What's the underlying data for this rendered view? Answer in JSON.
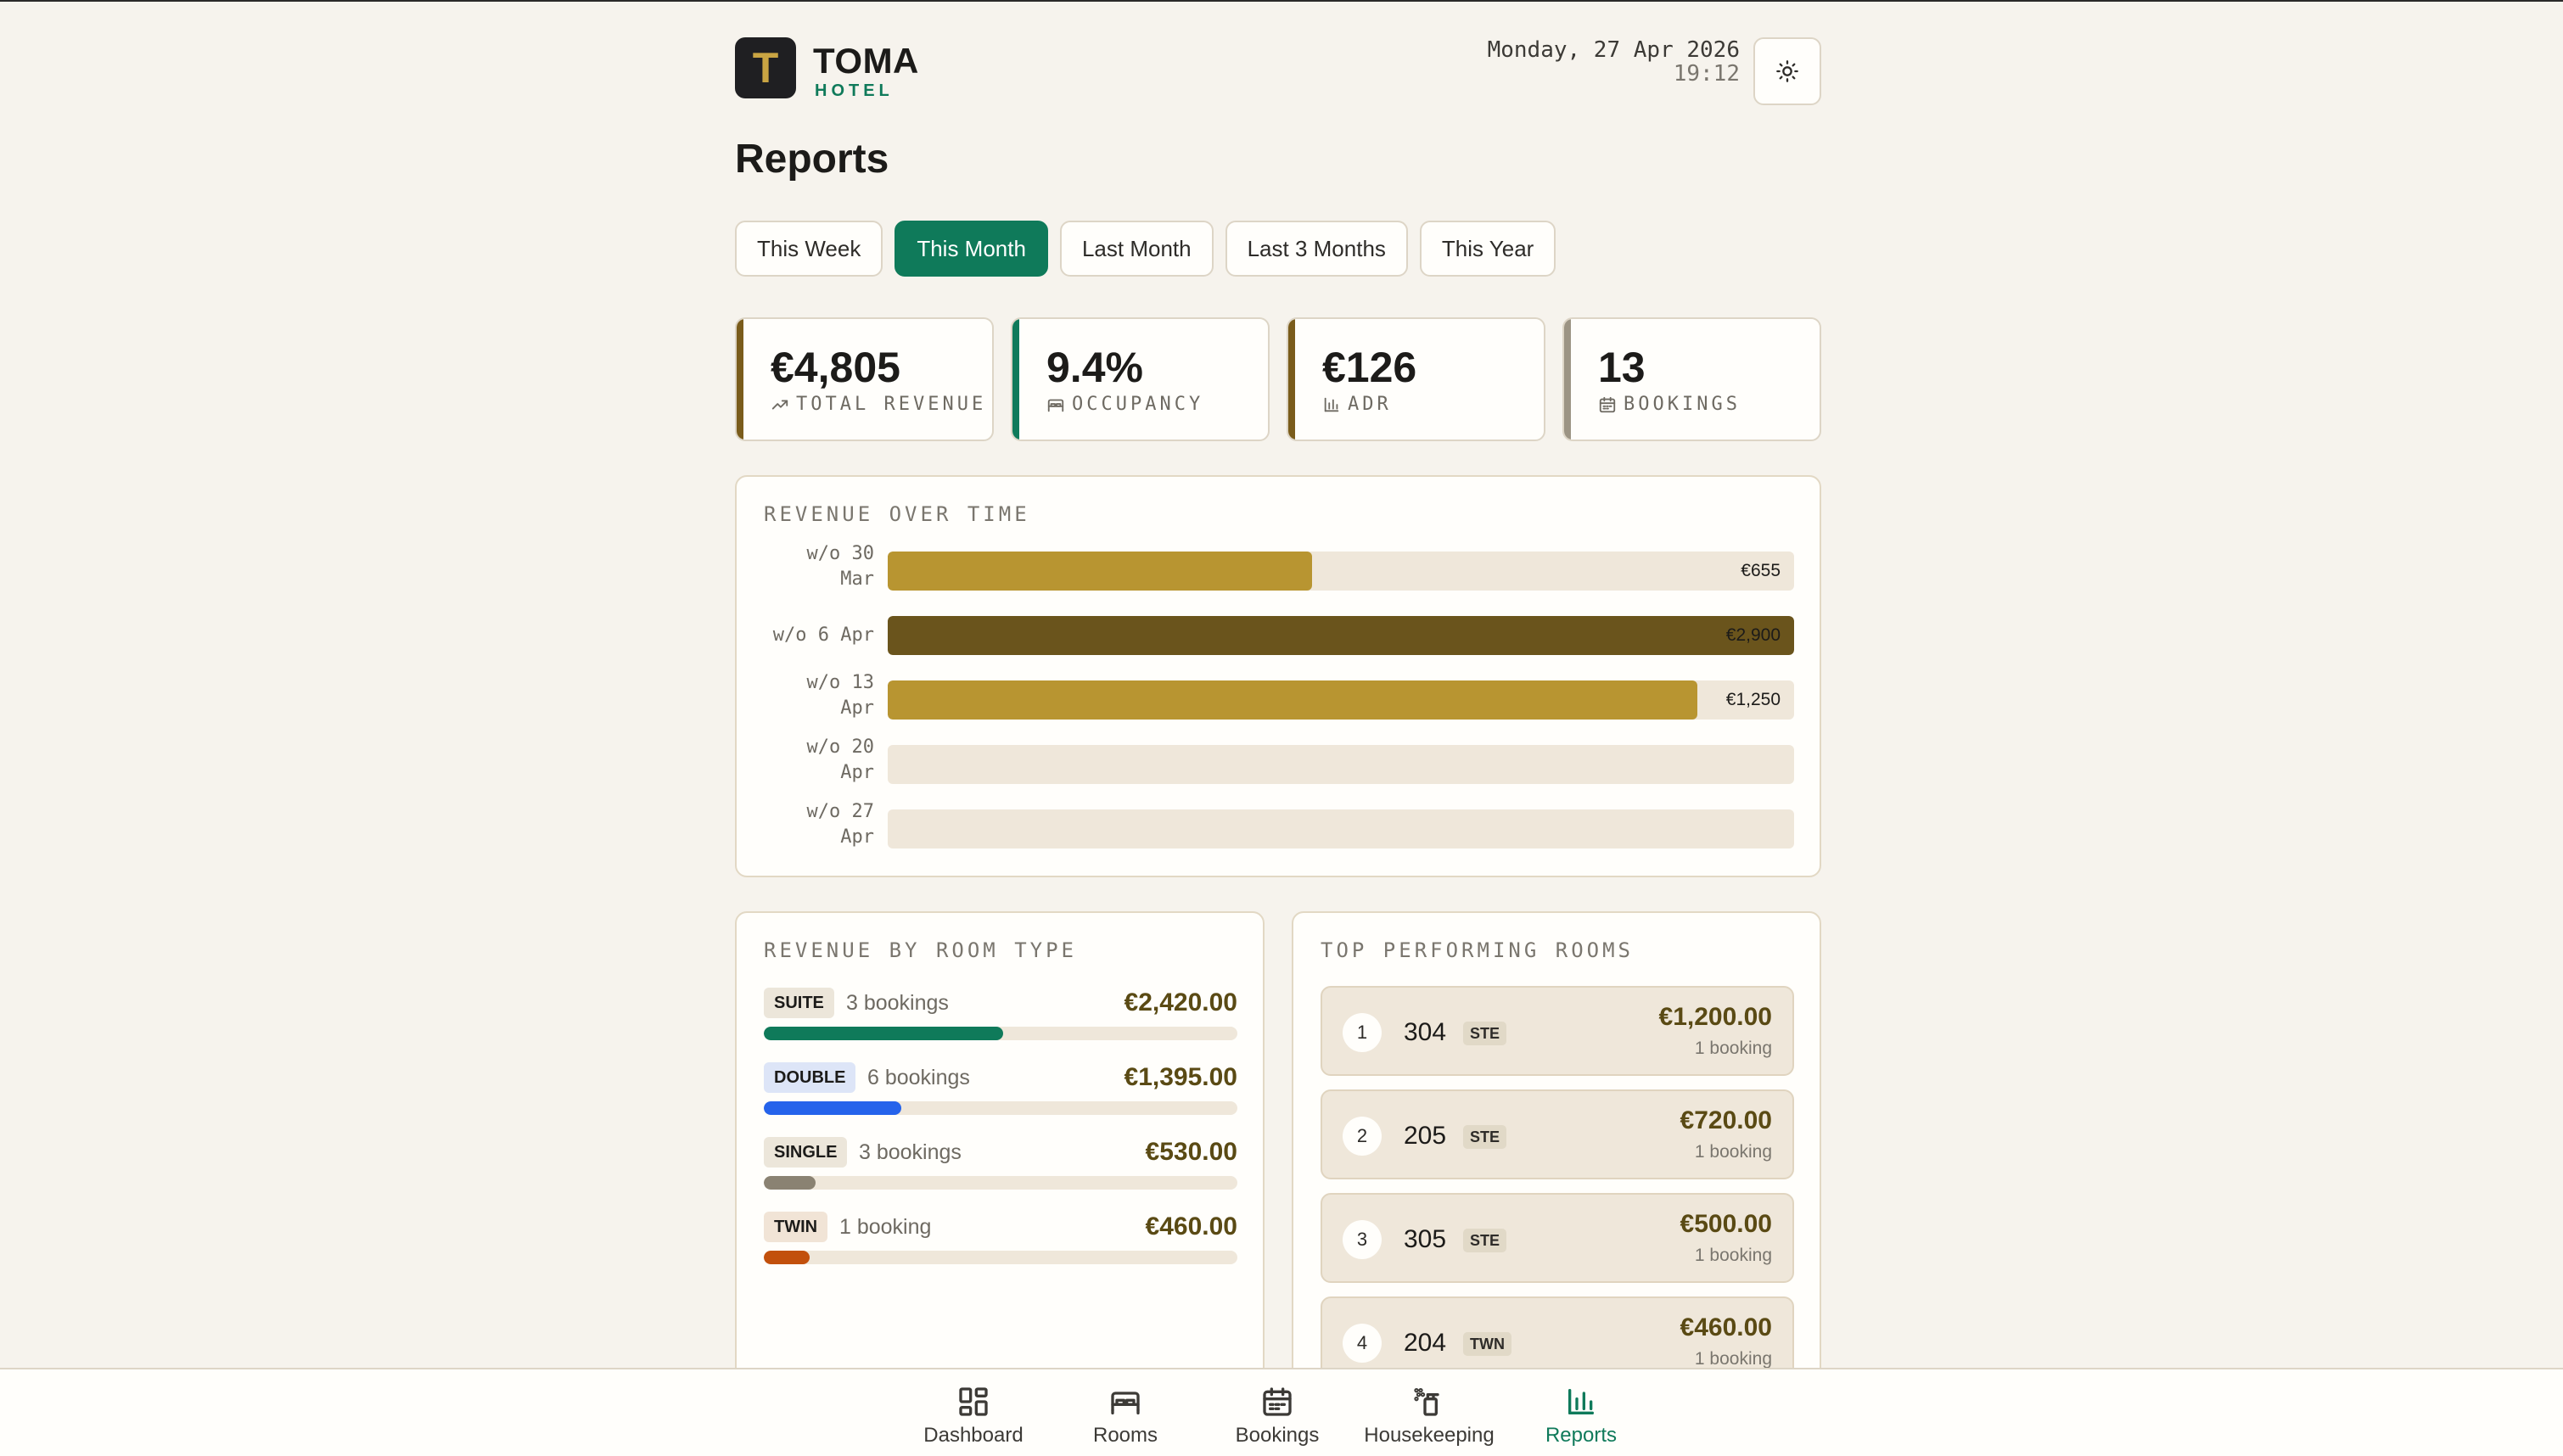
{
  "brand": {
    "initial": "T",
    "name": "TOMA",
    "subtitle": "HOTEL"
  },
  "header": {
    "date": "Monday, 27 Apr 2026",
    "time": "19:12",
    "theme_toggle_icon": "sun-icon"
  },
  "page": {
    "title": "Reports"
  },
  "periods": {
    "selected": "This Month",
    "items": [
      "This Week",
      "This Month",
      "Last Month",
      "Last 3 Months",
      "This Year"
    ]
  },
  "kpis": [
    {
      "value": "€4,805",
      "label": "TOTAL REVENUE",
      "icon": "trending-up-icon",
      "accent": "#7a5c1b"
    },
    {
      "value": "9.4%",
      "label": "OCCUPANCY",
      "icon": "bed-icon",
      "accent": "#0f7a5a"
    },
    {
      "value": "€126",
      "label": "ADR",
      "icon": "bar-chart-icon",
      "accent": "#7a5c1b"
    },
    {
      "value": "13",
      "label": "BOOKINGS",
      "icon": "calendar-icon",
      "accent": "#9c9484"
    }
  ],
  "revenue_over_time": {
    "title": "REVENUE OVER TIME",
    "rows": [
      {
        "label_lines": [
          "w/o 30",
          "Mar"
        ],
        "value": "€655",
        "fraction": 0.468,
        "color": "#b89531"
      },
      {
        "label_lines": [
          "w/o 6 Apr"
        ],
        "value": "€2,900",
        "fraction": 1.0,
        "color": "#6a541c"
      },
      {
        "label_lines": [
          "w/o 13",
          "Apr"
        ],
        "value": "€1,250",
        "fraction": 0.893,
        "color": "#b89531"
      },
      {
        "label_lines": [
          "w/o 20",
          "Apr"
        ],
        "value": "",
        "fraction": 0,
        "color": "#b89531"
      },
      {
        "label_lines": [
          "w/o 27",
          "Apr"
        ],
        "value": "",
        "fraction": 0,
        "color": "#b89531"
      }
    ]
  },
  "revenue_by_room_type": {
    "title": "REVENUE BY ROOM TYPE",
    "rows": [
      {
        "type": "SUITE",
        "count": "3 bookings",
        "amount": "€2,420.00",
        "fraction": 0.505,
        "color": "#0f7a5a",
        "badge_bg": "#ece6da"
      },
      {
        "type": "DOUBLE",
        "count": "6 bookings",
        "amount": "€1,395.00",
        "fraction": 0.29,
        "color": "#2563eb",
        "badge_bg": "#dde5f7"
      },
      {
        "type": "SINGLE",
        "count": "3 bookings",
        "amount": "€530.00",
        "fraction": 0.11,
        "color": "#8a8272",
        "badge_bg": "#ece6da"
      },
      {
        "type": "TWIN",
        "count": "1 booking",
        "amount": "€460.00",
        "fraction": 0.096,
        "color": "#c2500c",
        "badge_bg": "#f1e4d6"
      }
    ]
  },
  "top_rooms": {
    "title": "TOP PERFORMING ROOMS",
    "rows": [
      {
        "rank": "1",
        "room": "304",
        "type": "STE",
        "amount": "€1,200.00",
        "bookings": "1 booking"
      },
      {
        "rank": "2",
        "room": "205",
        "type": "STE",
        "amount": "€720.00",
        "bookings": "1 booking"
      },
      {
        "rank": "3",
        "room": "305",
        "type": "STE",
        "amount": "€500.00",
        "bookings": "1 booking"
      },
      {
        "rank": "4",
        "room": "204",
        "type": "TWN",
        "amount": "€460.00",
        "bookings": "1 booking"
      }
    ]
  },
  "nav": {
    "active": "Reports",
    "items": [
      {
        "label": "Dashboard",
        "icon": "dashboard-icon"
      },
      {
        "label": "Rooms",
        "icon": "bed-icon"
      },
      {
        "label": "Bookings",
        "icon": "calendar-icon"
      },
      {
        "label": "Housekeeping",
        "icon": "spray-bottle-icon"
      },
      {
        "label": "Reports",
        "icon": "bar-chart-icon"
      }
    ]
  }
}
